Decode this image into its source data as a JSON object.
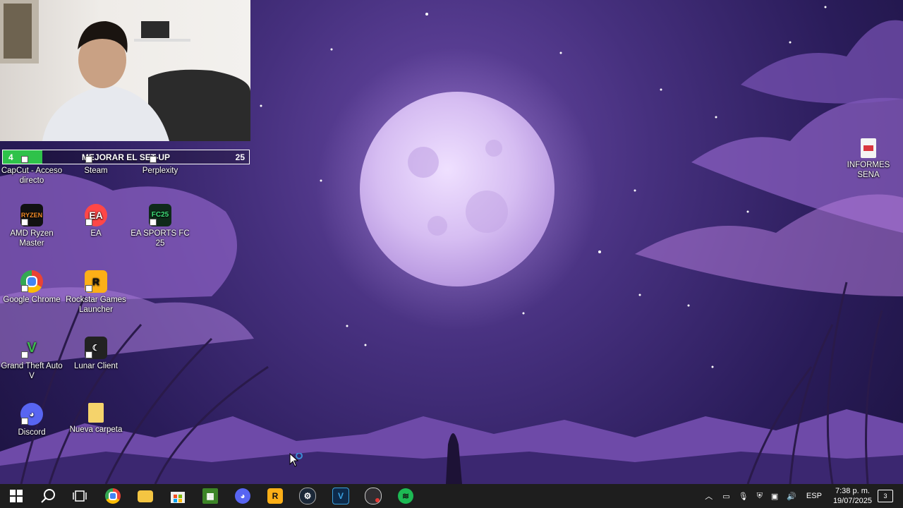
{
  "overlay": {
    "goal_current": "4",
    "goal_title": "MEJORAR EL SET-UP",
    "goal_target": "25",
    "goal_progress": 0.16
  },
  "desktop": {
    "icons": [
      {
        "id": "capcut",
        "label": "CapCut - Acceso directo",
        "icon": "capcut-icon"
      },
      {
        "id": "steam",
        "label": "Steam",
        "icon": "steam-icon"
      },
      {
        "id": "perplexity",
        "label": "Perplexity",
        "icon": "perplexity-icon"
      },
      {
        "id": "informes",
        "label": "INFORMES SENA",
        "icon": "pdf-document-icon"
      },
      {
        "id": "amd",
        "label": "AMD Ryzen Master",
        "icon": "amd-ryzen-icon"
      },
      {
        "id": "ea",
        "label": "EA",
        "icon": "ea-icon"
      },
      {
        "id": "fc25",
        "label": "EA SPORTS FC 25",
        "icon": "fc25-icon"
      },
      {
        "id": "chrome",
        "label": "Google Chrome",
        "icon": "chrome-icon"
      },
      {
        "id": "rockstar",
        "label": "Rockstar Games Launcher",
        "icon": "rockstar-icon"
      },
      {
        "id": "gta",
        "label": "Grand Theft Auto V",
        "icon": "gta-v-icon"
      },
      {
        "id": "lunar",
        "label": "Lunar Client",
        "icon": "lunar-client-icon"
      },
      {
        "id": "discord",
        "label": "Discord",
        "icon": "discord-icon"
      },
      {
        "id": "carpeta",
        "label": "Nueva carpeta",
        "icon": "folder-icon"
      }
    ]
  },
  "taskbar": {
    "pinned": [
      {
        "id": "start",
        "icon": "windows-start-icon",
        "color": "#ffffff"
      },
      {
        "id": "search",
        "icon": "search-icon",
        "color": "#ffffff"
      },
      {
        "id": "taskview",
        "icon": "task-view-icon",
        "color": "#ffffff"
      },
      {
        "id": "chrome",
        "icon": "chrome-icon",
        "color": "#ea4335"
      },
      {
        "id": "explorer",
        "icon": "file-explorer-icon",
        "color": "#f4c542"
      },
      {
        "id": "store",
        "icon": "microsoft-store-icon",
        "color": "#f25022"
      },
      {
        "id": "minecraft",
        "icon": "minecraft-icon",
        "color": "#3c8527"
      },
      {
        "id": "discord",
        "icon": "discord-icon",
        "color": "#5865f2"
      },
      {
        "id": "rockstar",
        "icon": "rockstar-icon",
        "color": "#fcaf17"
      },
      {
        "id": "steam",
        "icon": "steam-icon",
        "color": "#1b2838"
      },
      {
        "id": "vegas",
        "icon": "vegas-icon",
        "color": "#0d2a4a"
      },
      {
        "id": "obs",
        "icon": "obs-icon",
        "color": "#302e31"
      },
      {
        "id": "spotify",
        "icon": "spotify-icon",
        "color": "#1db954"
      }
    ],
    "tray": {
      "language": "ESP",
      "time": "7:38 p. m.",
      "date": "19/07/2025",
      "notifications": "3"
    }
  }
}
